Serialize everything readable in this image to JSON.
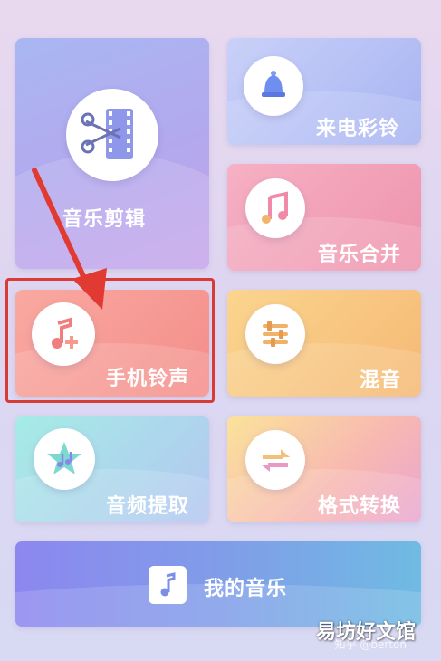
{
  "tiles": {
    "edit": {
      "label": "音乐剪辑",
      "icon": "scissors-film-icon"
    },
    "ringtone_call": {
      "label": "来电彩铃",
      "icon": "bell-icon"
    },
    "merge": {
      "label": "音乐合并",
      "icon": "music-note-icon"
    },
    "phone_ringtone": {
      "label": "手机铃声",
      "icon": "music-plus-icon"
    },
    "mix": {
      "label": "混音",
      "icon": "equalizer-icon"
    },
    "extract": {
      "label": "音频提取",
      "icon": "star-music-icon"
    },
    "format": {
      "label": "格式转换",
      "icon": "convert-arrows-icon"
    },
    "my_music": {
      "label": "我的音乐",
      "icon": "music-note-icon"
    }
  },
  "watermark": {
    "main": "易坊好文馆",
    "sub": "知乎 @berton"
  },
  "colors": {
    "highlight": "#d83a35",
    "arrow": "#e03a33"
  }
}
